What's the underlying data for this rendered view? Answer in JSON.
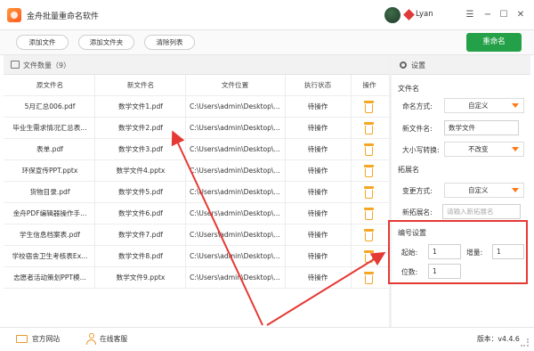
{
  "app": {
    "title": "金舟批量重命名软件",
    "user": "Lyan",
    "window_buttons": {
      "menu": "☰",
      "minimize": "−",
      "maximize": "☐",
      "close": "✕"
    }
  },
  "toolbar": {
    "add_file": "添加文件",
    "add_folder": "添加文件夹",
    "clear_list": "清除列表",
    "rename": "重命名"
  },
  "file_panel": {
    "title": "文件数量（9）"
  },
  "table": {
    "headers": [
      "原文件名",
      "新文件名",
      "文件位置",
      "执行状态",
      "操作"
    ],
    "rows": [
      {
        "original": "5月汇总006.pdf",
        "new": "数学文件1.pdf",
        "location": "C:\\Users\\admin\\Desktop\\...",
        "status": "待操作"
      },
      {
        "original": "毕业生需求情况汇总表...",
        "new": "数学文件2.pdf",
        "location": "C:\\Users\\admin\\Desktop\\...",
        "status": "待操作"
      },
      {
        "original": "表单.pdf",
        "new": "数学文件3.pdf",
        "location": "C:\\Users\\admin\\Desktop\\...",
        "status": "待操作"
      },
      {
        "original": "环保宣传PPT.pptx",
        "new": "数学文件4.pptx",
        "location": "C:\\Users\\admin\\Desktop\\...",
        "status": "待操作"
      },
      {
        "original": "货物目录.pdf",
        "new": "数学文件5.pdf",
        "location": "C:\\Users\\admin\\Desktop\\...",
        "status": "待操作"
      },
      {
        "original": "金舟PDF编辑器操作手...",
        "new": "数学文件6.pdf",
        "location": "C:\\Users\\admin\\Desktop\\...",
        "status": "待操作"
      },
      {
        "original": "学生信息档案表.pdf",
        "new": "数学文件7.pdf",
        "location": "C:\\Users\\admin\\Desktop\\...",
        "status": "待操作"
      },
      {
        "original": "学校宿舍卫生考核表Ex...",
        "new": "数学文件8.pdf",
        "location": "C:\\Users\\admin\\Desktop\\...",
        "status": "待操作"
      },
      {
        "original": "志愿者活动策划PPT模...",
        "new": "数学文件9.pptx",
        "location": "C:\\Users\\admin\\Desktop\\...",
        "status": "待操作"
      }
    ]
  },
  "settings": {
    "title": "设置",
    "filename_section": "文件名",
    "naming_method_label": "命名方式:",
    "naming_method_value": "自定义",
    "new_name_label": "新文件名:",
    "new_name_value": "数学文件",
    "case_label": "大小写转换:",
    "case_value": "不改变",
    "ext_section": "拓展名",
    "ext_method_label": "变更方式:",
    "ext_method_value": "自定义",
    "new_ext_label": "新拓展名:",
    "new_ext_placeholder": "请输入新拓展名",
    "numbering_section": "编号设置",
    "start_label": "起始:",
    "start_value": "1",
    "increment_label": "增量:",
    "increment_value": "1",
    "digits_label": "位数:",
    "digits_value": "1"
  },
  "statusbar": {
    "website": "官方网站",
    "support": "在线客服",
    "version": "版本：v4.4.6"
  },
  "colors": {
    "accent_green": "#24a148",
    "highlight_red": "#e53935",
    "icon_orange": "#f5a623"
  }
}
